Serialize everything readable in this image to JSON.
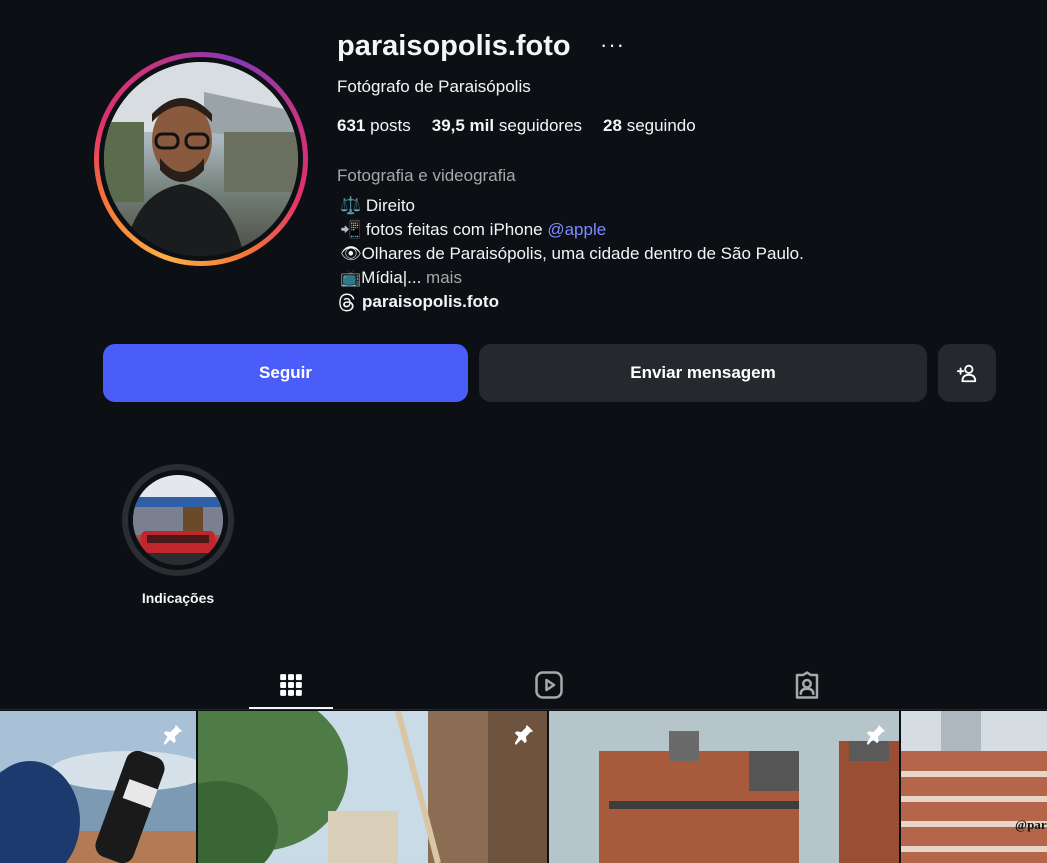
{
  "profile": {
    "username": "paraisopolis.foto",
    "more_label": "···",
    "subtitle": "Fotógrafo de Paraisópolis",
    "stats": {
      "posts_count": "631",
      "posts_label": "posts",
      "followers_count": "39,5 mil",
      "followers_label": "seguidores",
      "following_count": "28",
      "following_label": "seguindo"
    },
    "category": "Fotografia e videografia",
    "bio": {
      "line1": "⚖️ Direito",
      "line2": "📲 fotos feitas com iPhone ",
      "line2_link": "@apple",
      "line3": "👁Olhares de Paraisópolis, uma cidade dentro de São Paulo.",
      "line4": "📺Mídia|... ",
      "more": "mais"
    },
    "threads_handle": "paraisopolis.foto"
  },
  "actions": {
    "follow_label": "Seguir",
    "message_label": "Enviar mensagem",
    "add_icon": "person-add-icon"
  },
  "highlights": [
    {
      "label": "Indicações"
    }
  ],
  "tabs": [
    {
      "name": "posts",
      "icon": "grid-icon",
      "active": true
    },
    {
      "name": "reels",
      "icon": "reels-icon",
      "active": false
    },
    {
      "name": "tagged",
      "icon": "tagged-icon",
      "active": false
    }
  ],
  "grid": {
    "items": [
      {
        "pinned": true
      },
      {
        "pinned": true
      },
      {
        "pinned": true
      },
      {
        "pinned": false,
        "watermark": "@par"
      }
    ]
  },
  "colors": {
    "background": "#0c0f14",
    "follow_button": "#4a5df9",
    "secondary_button": "#25292e",
    "link": "#7e8bff",
    "muted_text": "#a8a8a8"
  }
}
